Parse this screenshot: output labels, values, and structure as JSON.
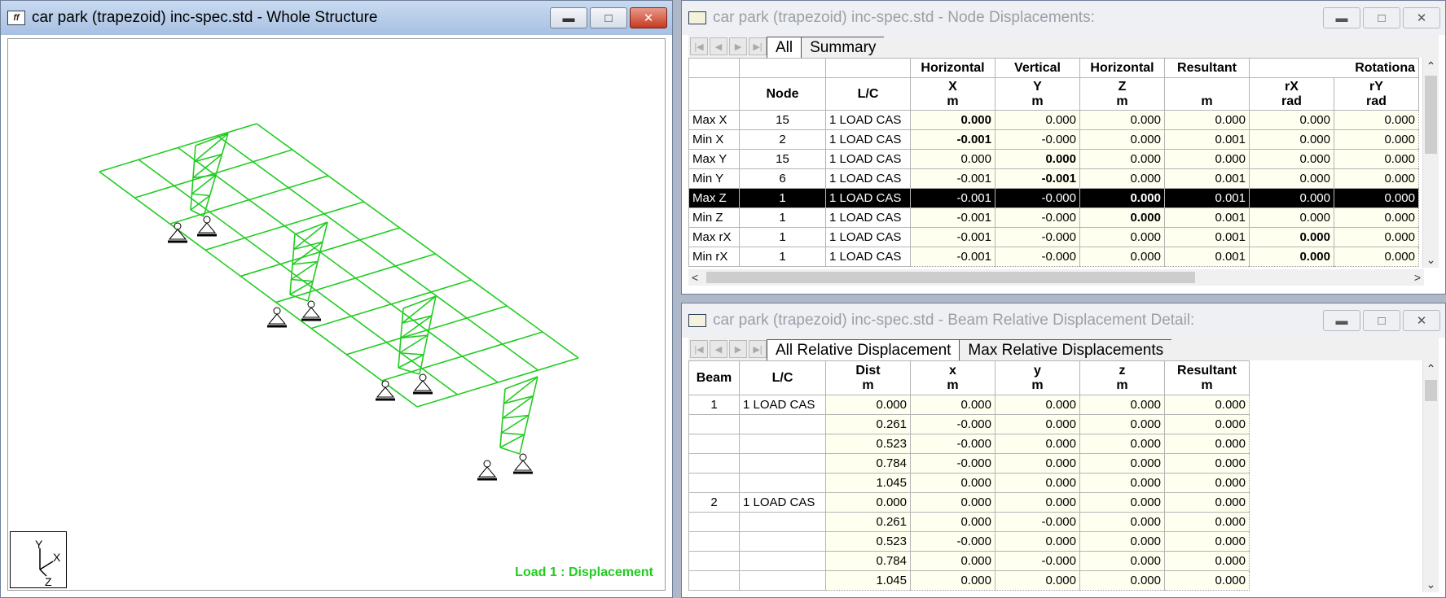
{
  "windows": {
    "structure": {
      "title": "car park (trapezoid) inc-spec.std - Whole Structure",
      "app_icon": "ff",
      "axis": {
        "y": "Y",
        "x": "X",
        "z": "Z"
      },
      "load_label": "Load 1 : Displacement",
      "member_color": "#22cc22"
    },
    "node_displacements": {
      "title": "car park (trapezoid) inc-spec.std - Node Displacements:",
      "tabs": [
        "All",
        "Summary"
      ],
      "group_headers": [
        "Horizontal",
        "Vertical",
        "Horizontal",
        "Resultant",
        "Rotationa"
      ],
      "col_headers": [
        "Node",
        "L/C",
        "X",
        "Y",
        "Z",
        "",
        "rX",
        "rY"
      ],
      "col_units": [
        "",
        "",
        "m",
        "m",
        "m",
        "m",
        "rad",
        "rad"
      ],
      "rows": [
        {
          "label": "Max X",
          "node": "15",
          "lc": "1 LOAD CAS",
          "x": "0.000",
          "y": "0.000",
          "z": "0.000",
          "r": "0.000",
          "rx": "0.000",
          "ry": "0.000",
          "bold": "x"
        },
        {
          "label": "Min X",
          "node": "2",
          "lc": "1 LOAD CAS",
          "x": "-0.001",
          "y": "-0.000",
          "z": "0.000",
          "r": "0.001",
          "rx": "0.000",
          "ry": "0.000",
          "bold": "x"
        },
        {
          "label": "Max Y",
          "node": "15",
          "lc": "1 LOAD CAS",
          "x": "0.000",
          "y": "0.000",
          "z": "0.000",
          "r": "0.000",
          "rx": "0.000",
          "ry": "0.000",
          "bold": "y"
        },
        {
          "label": "Min Y",
          "node": "6",
          "lc": "1 LOAD CAS",
          "x": "-0.001",
          "y": "-0.001",
          "z": "0.000",
          "r": "0.001",
          "rx": "0.000",
          "ry": "0.000",
          "bold": "y"
        },
        {
          "label": "Max Z",
          "node": "1",
          "lc": "1 LOAD CAS",
          "x": "-0.001",
          "y": "-0.000",
          "z": "0.000",
          "r": "0.001",
          "rx": "0.000",
          "ry": "0.000",
          "bold": "z",
          "selected": true
        },
        {
          "label": "Min Z",
          "node": "1",
          "lc": "1 LOAD CAS",
          "x": "-0.001",
          "y": "-0.000",
          "z": "0.000",
          "r": "0.001",
          "rx": "0.000",
          "ry": "0.000",
          "bold": "z"
        },
        {
          "label": "Max rX",
          "node": "1",
          "lc": "1 LOAD CAS",
          "x": "-0.001",
          "y": "-0.000",
          "z": "0.000",
          "r": "0.001",
          "rx": "0.000",
          "ry": "0.000",
          "bold": "rx"
        },
        {
          "label": "Min rX",
          "node": "1",
          "lc": "1 LOAD CAS",
          "x": "-0.001",
          "y": "-0.000",
          "z": "0.000",
          "r": "0.001",
          "rx": "0.000",
          "ry": "0.000",
          "bold": "rx"
        }
      ]
    },
    "beam_relative": {
      "title": "car park (trapezoid) inc-spec.std - Beam Relative Displacement Detail:",
      "tabs": [
        "All Relative Displacement",
        "Max Relative Displacements"
      ],
      "col_headers": [
        "Beam",
        "L/C",
        "Dist",
        "x",
        "y",
        "z",
        "Resultant"
      ],
      "col_units": [
        "",
        "",
        "m",
        "m",
        "m",
        "m",
        "m"
      ],
      "rows": [
        {
          "beam": "1",
          "lc": "1 LOAD CAS",
          "dist": "0.000",
          "x": "0.000",
          "y": "0.000",
          "z": "0.000",
          "r": "0.000"
        },
        {
          "beam": "",
          "lc": "",
          "dist": "0.261",
          "x": "-0.000",
          "y": "0.000",
          "z": "0.000",
          "r": "0.000"
        },
        {
          "beam": "",
          "lc": "",
          "dist": "0.523",
          "x": "-0.000",
          "y": "0.000",
          "z": "0.000",
          "r": "0.000"
        },
        {
          "beam": "",
          "lc": "",
          "dist": "0.784",
          "x": "-0.000",
          "y": "0.000",
          "z": "0.000",
          "r": "0.000"
        },
        {
          "beam": "",
          "lc": "",
          "dist": "1.045",
          "x": "0.000",
          "y": "0.000",
          "z": "0.000",
          "r": "0.000"
        },
        {
          "beam": "2",
          "lc": "1 LOAD CAS",
          "dist": "0.000",
          "x": "0.000",
          "y": "0.000",
          "z": "0.000",
          "r": "0.000"
        },
        {
          "beam": "",
          "lc": "",
          "dist": "0.261",
          "x": "0.000",
          "y": "-0.000",
          "z": "0.000",
          "r": "0.000"
        },
        {
          "beam": "",
          "lc": "",
          "dist": "0.523",
          "x": "-0.000",
          "y": "0.000",
          "z": "0.000",
          "r": "0.000"
        },
        {
          "beam": "",
          "lc": "",
          "dist": "0.784",
          "x": "0.000",
          "y": "-0.000",
          "z": "0.000",
          "r": "0.000"
        },
        {
          "beam": "",
          "lc": "",
          "dist": "1.045",
          "x": "0.000",
          "y": "0.000",
          "z": "0.000",
          "r": "0.000"
        }
      ]
    }
  }
}
